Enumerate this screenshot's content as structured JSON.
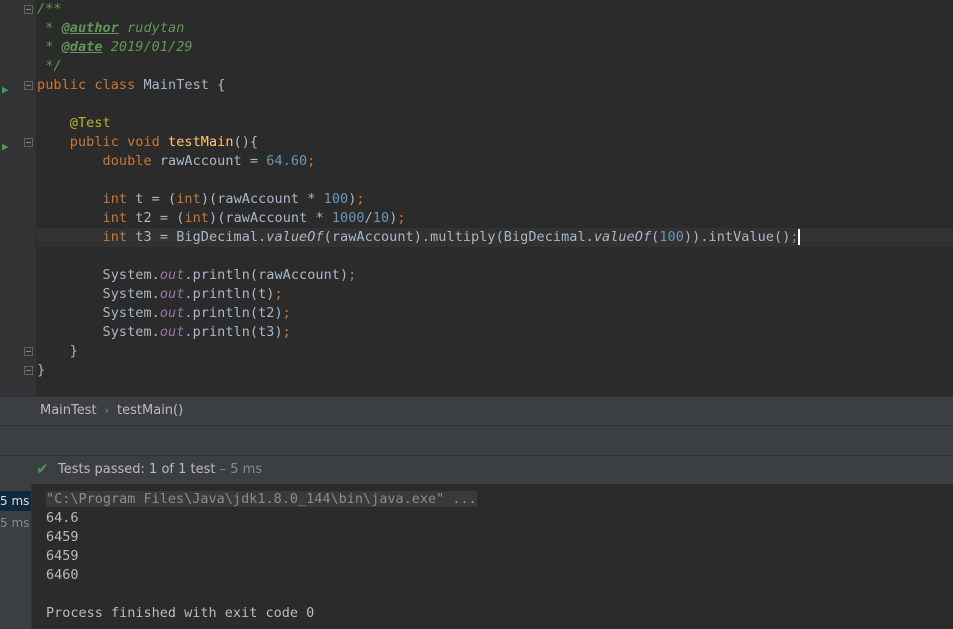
{
  "editor": {
    "lines": [
      {
        "segments": [
          {
            "t": "/**",
            "c": "cmt"
          }
        ]
      },
      {
        "segments": [
          {
            "t": " * ",
            "c": "cmt"
          },
          {
            "t": "@author",
            "c": "tag"
          },
          {
            "t": " rudytan",
            "c": "cmt"
          }
        ]
      },
      {
        "segments": [
          {
            "t": " * ",
            "c": "cmt"
          },
          {
            "t": "@date",
            "c": "tag"
          },
          {
            "t": " 2019/01/29",
            "c": "cmt"
          }
        ]
      },
      {
        "segments": [
          {
            "t": " */",
            "c": "cmt"
          }
        ]
      },
      {
        "segments": [
          {
            "t": "public class ",
            "c": "kw"
          },
          {
            "t": "MainTest {",
            "c": ""
          }
        ]
      },
      {
        "segments": []
      },
      {
        "segments": [
          {
            "t": "    ",
            "c": ""
          },
          {
            "t": "@Test",
            "c": "ann"
          }
        ]
      },
      {
        "segments": [
          {
            "t": "    ",
            "c": ""
          },
          {
            "t": "public void ",
            "c": "kw"
          },
          {
            "t": "testMain",
            "c": "fn"
          },
          {
            "t": "(){",
            "c": ""
          }
        ]
      },
      {
        "segments": [
          {
            "t": "        ",
            "c": ""
          },
          {
            "t": "double ",
            "c": "kw"
          },
          {
            "t": "rawAccount = ",
            "c": ""
          },
          {
            "t": "64.60",
            "c": "num"
          },
          {
            "t": ";",
            "c": "kw"
          }
        ]
      },
      {
        "segments": []
      },
      {
        "segments": [
          {
            "t": "        ",
            "c": ""
          },
          {
            "t": "int ",
            "c": "kw"
          },
          {
            "t": "t = (",
            "c": ""
          },
          {
            "t": "int",
            "c": "kw"
          },
          {
            "t": ")(rawAccount * ",
            "c": ""
          },
          {
            "t": "100",
            "c": "num"
          },
          {
            "t": ")",
            "c": ""
          },
          {
            "t": ";",
            "c": "kw"
          }
        ]
      },
      {
        "segments": [
          {
            "t": "        ",
            "c": ""
          },
          {
            "t": "int ",
            "c": "kw"
          },
          {
            "t": "t2 = (",
            "c": ""
          },
          {
            "t": "int",
            "c": "kw"
          },
          {
            "t": ")(rawAccount * ",
            "c": ""
          },
          {
            "t": "1000",
            "c": "num"
          },
          {
            "t": "/",
            "c": ""
          },
          {
            "t": "10",
            "c": "num"
          },
          {
            "t": ")",
            "c": ""
          },
          {
            "t": ";",
            "c": "kw"
          }
        ]
      },
      {
        "current": true,
        "segments": [
          {
            "t": "        ",
            "c": ""
          },
          {
            "t": "int ",
            "c": "kw"
          },
          {
            "t": "t3 = BigDecimal.",
            "c": ""
          },
          {
            "t": "valueOf",
            "c": "it"
          },
          {
            "t": "(rawAccount).multiply(BigDecimal.",
            "c": ""
          },
          {
            "t": "valueOf",
            "c": "it"
          },
          {
            "t": "(",
            "c": ""
          },
          {
            "t": "100",
            "c": "num"
          },
          {
            "t": ")).intValue()",
            "c": ""
          },
          {
            "t": ";",
            "c": "kw"
          },
          {
            "t": "",
            "c": "caret"
          }
        ]
      },
      {
        "segments": []
      },
      {
        "segments": [
          {
            "t": "        System.",
            "c": ""
          },
          {
            "t": "out",
            "c": "st"
          },
          {
            "t": ".println(rawAccount)",
            "c": ""
          },
          {
            "t": ";",
            "c": "kw"
          }
        ]
      },
      {
        "segments": [
          {
            "t": "        System.",
            "c": ""
          },
          {
            "t": "out",
            "c": "st"
          },
          {
            "t": ".println(t)",
            "c": ""
          },
          {
            "t": ";",
            "c": "kw"
          }
        ]
      },
      {
        "segments": [
          {
            "t": "        System.",
            "c": ""
          },
          {
            "t": "out",
            "c": "st"
          },
          {
            "t": ".println(t2)",
            "c": ""
          },
          {
            "t": ";",
            "c": "kw"
          }
        ]
      },
      {
        "segments": [
          {
            "t": "        System.",
            "c": ""
          },
          {
            "t": "out",
            "c": "st"
          },
          {
            "t": ".println(t3)",
            "c": ""
          },
          {
            "t": ";",
            "c": "kw"
          }
        ]
      },
      {
        "segments": [
          {
            "t": "    }",
            "c": ""
          }
        ]
      },
      {
        "segments": [
          {
            "t": "}",
            "c": ""
          }
        ]
      }
    ]
  },
  "breadcrumb": {
    "class_name": "MainTest",
    "method_name": "testMain()"
  },
  "test_status": {
    "prefix": "Tests passed: ",
    "result": "1",
    "mid": " of 1 test",
    "duration": " – 5 ms"
  },
  "test_tree": {
    "rows": [
      "5 ms",
      "5 ms"
    ]
  },
  "console": {
    "command": "\"C:\\Program Files\\Java\\jdk1.8.0_144\\bin\\java.exe\" ...",
    "outputs": [
      "64.6",
      "6459",
      "6459",
      "6460"
    ],
    "exit_message": "Process finished with exit code 0"
  },
  "icons": {
    "run_gutter": "run-gutter-icon",
    "fold": "fold-marker-icon",
    "check": "check-icon"
  },
  "colors": {
    "background": "#2b2b2b",
    "keyword": "#cc7832",
    "number": "#6897bb",
    "comment": "#629755",
    "annotation": "#bbb529",
    "function": "#ffc66d",
    "static_field": "#9876aa",
    "pass_green": "#499c54"
  }
}
